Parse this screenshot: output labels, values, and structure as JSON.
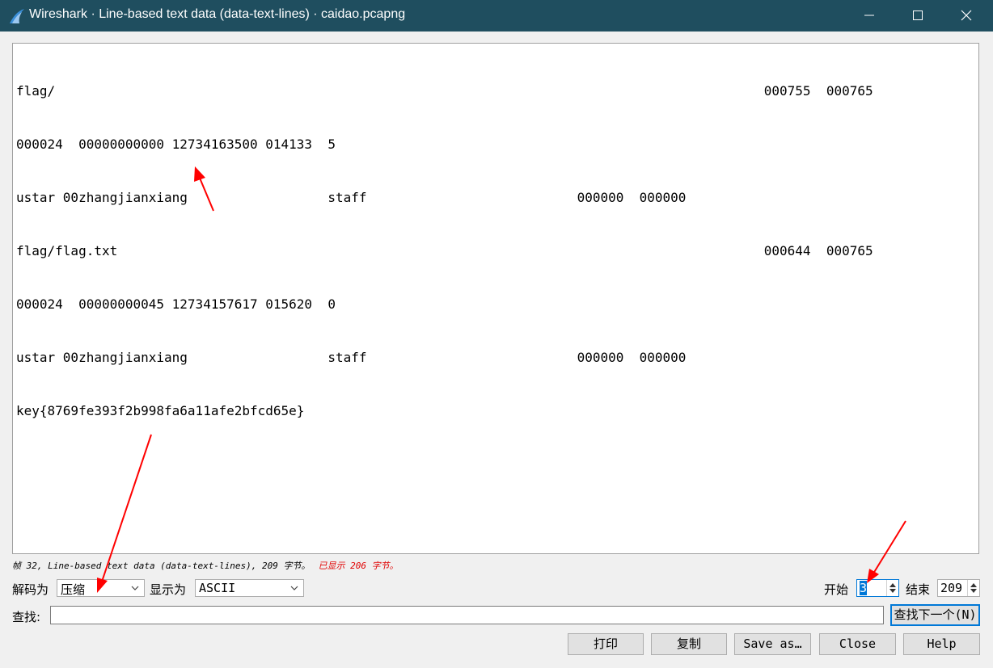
{
  "window": {
    "title": "Wireshark · Line-based text data (data-text-lines) · caidao.pcapng",
    "minimize_icon": "minimize-icon",
    "maximize_icon": "maximize-icon",
    "close_icon": "close-icon"
  },
  "content": {
    "lines": [
      "flag/                                                                                           000755  000765",
      "000024  00000000000 12734163500 014133  5",
      "ustar 00zhangjianxiang                  staff                           000000  000000",
      "flag/flag.txt                                                                                   000644  000765",
      "000024  00000000045 12734157617 015620  0",
      "ustar 00zhangjianxiang                  staff                           000000  000000",
      "key{8769fe393f2b998fa6a11afe2bfcd65e}"
    ]
  },
  "status": {
    "text": "帧 32, Line-based text data (data-text-lines), 209 字节。",
    "shown": "已显示 206 字节。"
  },
  "controls": {
    "decode_label": "解码为",
    "decode_value": "压缩",
    "show_label": "显示为",
    "show_value": "ASCII",
    "start_label": "开始",
    "start_value": "3",
    "end_label": "结束",
    "end_value": "209"
  },
  "find": {
    "label": "查找:",
    "value": "",
    "next_button": "查找下一个(N)"
  },
  "buttons": {
    "print": "打印",
    "copy": "复制",
    "save_as": "Save as…",
    "close": "Close",
    "help": "Help"
  },
  "colors": {
    "titlebar": "#1f4e5f",
    "annotation_arrow": "#ff0000",
    "status_highlight": "#e00000"
  }
}
